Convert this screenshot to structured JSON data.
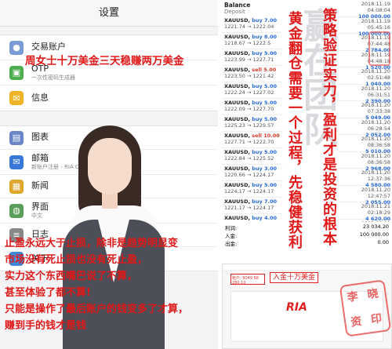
{
  "settings": {
    "title": "设置",
    "group1": [
      {
        "label": "交易账户",
        "sub": "",
        "icon": "user-icon",
        "color": "#7a9bd8"
      },
      {
        "label": "OTP",
        "sub": "一次性密码生成器",
        "icon": "lock-icon",
        "color": "#4cae4f"
      },
      {
        "label": "信息",
        "sub": "",
        "icon": "message-icon",
        "color": "#f0b429"
      }
    ],
    "group2": [
      {
        "label": "图表",
        "sub": "",
        "icon": "chart-icon",
        "color": "#6a86c8"
      },
      {
        "label": "邮箱",
        "sub": "新账户注册 - RIA Capital Markets Limited",
        "icon": "mail-icon",
        "color": "#3a78d8"
      },
      {
        "label": "新闻",
        "sub": "",
        "icon": "news-icon",
        "color": "#e0a72e"
      },
      {
        "label": "界面",
        "sub": "中文",
        "icon": "globe-icon",
        "color": "#5a9e5a"
      },
      {
        "label": "日志",
        "sub": "",
        "icon": "log-icon",
        "color": "#888888"
      },
      {
        "label": "关于",
        "sub": "",
        "icon": "info-icon",
        "color": "#3d8ad8"
      }
    ]
  },
  "trades": {
    "balance_label": "Balance",
    "deposit_label": "Deposit",
    "rows": [
      {
        "symbol": "XAUUSD,",
        "side": "buy",
        "lots": "7.00",
        "prices": "1221.74 → 1222.04"
      },
      {
        "symbol": "XAUUSD,",
        "side": "buy",
        "lots": "8.00",
        "prices": "1218.67 → 1222.5"
      },
      {
        "symbol": "XAUUSD,",
        "side": "buy",
        "lots": "5.00",
        "prices": "1223.99 → 1227.71"
      },
      {
        "symbol": "XAUUSD,",
        "side": "sell",
        "lots": "5.00",
        "prices": "1223.50 → 1221.42"
      },
      {
        "symbol": "XAUUSD,",
        "side": "buy",
        "lots": "5.00",
        "prices": "1222.24 → 1227.02"
      },
      {
        "symbol": "XAUUSD,",
        "side": "buy",
        "lots": "5.00",
        "prices": "1222.09 → 1227.70"
      },
      {
        "symbol": "XAUUSD,",
        "side": "buy",
        "lots": "5.00",
        "prices": "1225.23 → 1229.57"
      },
      {
        "symbol": "XAUUSD,",
        "side": "sell",
        "lots": "10.00",
        "prices": "1227.71 → 1222.70"
      },
      {
        "symbol": "XAUUSD,",
        "side": "buy",
        "lots": "5.00",
        "prices": "1222.84 → 1225.52"
      },
      {
        "symbol": "XAUUSD,",
        "side": "buy",
        "lots": "3.00",
        "prices": "1220.66 → 1224.17"
      },
      {
        "symbol": "XAUUSD,",
        "side": "buy",
        "lots": "5.00",
        "prices": "1224.17 → 1224.17"
      },
      {
        "symbol": "XAUUSD,",
        "side": "buy",
        "lots": "7.00",
        "prices": "1221.17 → 1224.17"
      },
      {
        "symbol": "XAUUSD,",
        "side": "buy",
        "lots": "4.00",
        "prices": "1221.09 → 1224.19"
      }
    ]
  },
  "dates": [
    {
      "time": "2018.11.19 04:08:04",
      "value": "100 000.00"
    },
    {
      "time": "2018.11.19 05:45:16",
      "value": "100 000.00"
    },
    {
      "time": "2018.11.19 07:44:48",
      "value": "2 784.00"
    },
    {
      "time": "2018.11.19 04:48:18",
      "value": "1 520.00"
    },
    {
      "time": "2018.11.20 02:51:48",
      "value": "1 040.00"
    },
    {
      "time": "2018.11.20 06:31:51",
      "value": "2 390.00"
    },
    {
      "time": "2018.11.20 07:33:38",
      "value": "5 049.00"
    },
    {
      "time": "2018.11.20 06:28:54",
      "value": "2 052.00"
    },
    {
      "time": "2018.11.20 08:36:58",
      "value": "5 010.00"
    },
    {
      "time": "2018.11.20 08:36:58",
      "value": "2 968.00"
    },
    {
      "time": "2018.11.20 12:37:36",
      "value": "4 580.00"
    },
    {
      "time": "2018.11.20 12:47:57",
      "value": "2 055.00"
    },
    {
      "time": "2018.11.21 02:18:29",
      "value": "4 620.00"
    },
    {
      "time": "2018.11.21 02:18:02",
      "value": "2 184.00"
    }
  ],
  "summary": {
    "rows": [
      {
        "label": "利润:",
        "value": "23 034.20"
      },
      {
        "label": "入金:",
        "value": "100 000.00"
      },
      {
        "label": "出金:",
        "value": "0.00"
      }
    ]
  },
  "shot": {
    "account_text": "账户: 9049 68 280.10",
    "deposit_text": "入金十万美金",
    "logo_text": "RIA"
  },
  "overlays": {
    "banner": "周女士十万美金三天稳赚两万美金",
    "vertical1": "黄金翻仓需要一个过程，先稳健获利",
    "vertical2": "策略验证实力，盈利才是投资的根本",
    "watermark": "赢在团队",
    "paragraph": [
      "止盈永远大于止损，除非是趋势明显变",
      "市场没有死止损也没有死止盈，",
      "实力这个东西嘴巴说了不算，",
      "甚至体验了都不算!",
      "只能是操作了最后账户的钱变多了才算，",
      "赚到手的钱才是钱"
    ],
    "seal_chars": [
      "李",
      "晓",
      "资",
      "印"
    ]
  }
}
